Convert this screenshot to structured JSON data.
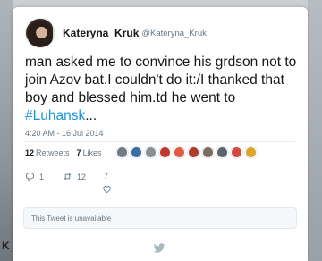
{
  "tweet": {
    "display_name": "Kateryna_Kruk",
    "handle": "@Kateryna_Kruk",
    "text": "man asked me to convince his grdson not to join Azov bat.I couldn't do it:/I thanked that boy and blessed him.td he went to ",
    "hashtag": "#Luhansk",
    "ellipsis": "...",
    "timestamp": "4:20 AM - 16 Jul 2014"
  },
  "stats": {
    "retweets_count": "12",
    "retweets_label": "Retweets",
    "likes_count": "7",
    "likes_label": "Likes"
  },
  "liker_colors": [
    "#6f7b86",
    "#3b6ea5",
    "#8a8f94",
    "#c0392b",
    "#e25b45",
    "#b03a2e",
    "#7d6b5d",
    "#5b6770",
    "#d44a3a",
    "#e0a32c"
  ],
  "actions": {
    "reply_count": "1",
    "retweet_count": "12",
    "like_count": "7"
  },
  "quoted": {
    "text": "This Tweet is unavailable"
  },
  "backdrop": {
    "letter": "K"
  },
  "colors": {
    "link": "#1b95e0",
    "muted": "#657786",
    "text": "#14171a"
  }
}
